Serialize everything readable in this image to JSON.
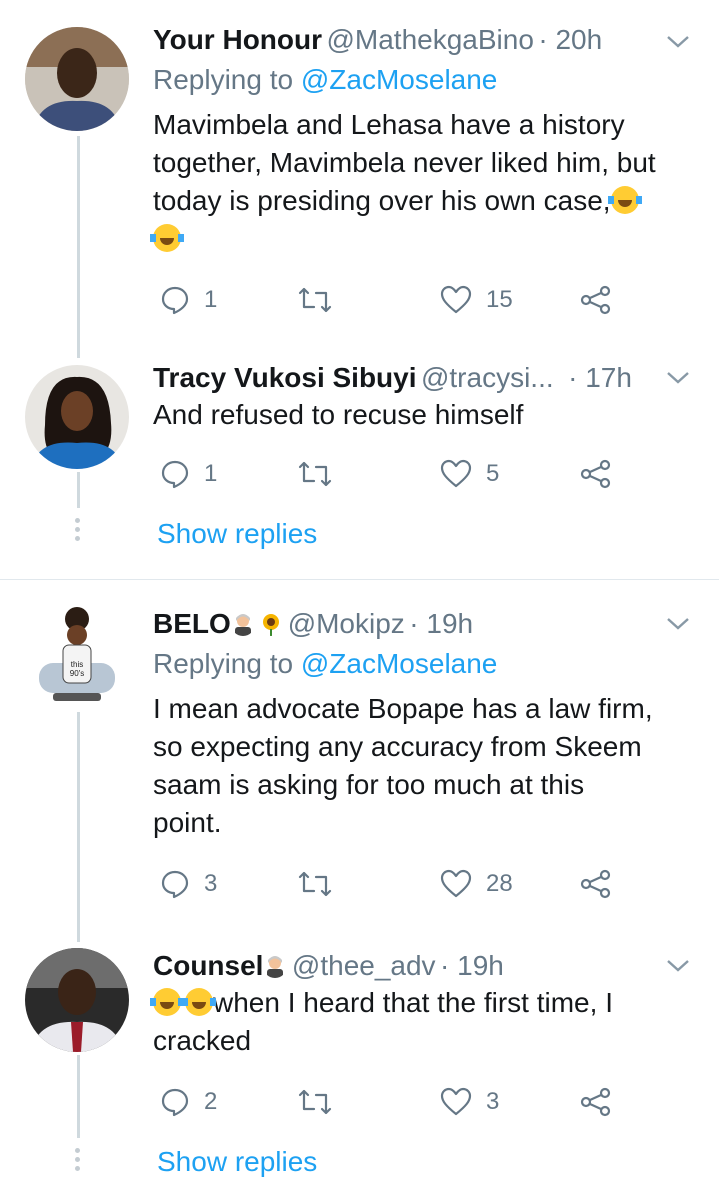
{
  "tweets": [
    {
      "name": "Your Honour",
      "handle": "@MathekgaBino",
      "time": "· 20h",
      "replying_prefix": "Replying to ",
      "replying_to": "@ZacMoselane",
      "text_line1": "Mavimbela and Lehasa have a history",
      "text_line2": "together, Mavimbela never liked him, but",
      "text_line3": "today is presiding over his own case,",
      "replies": "1",
      "likes": "15"
    },
    {
      "name": "Tracy Vukosi Sibuyi",
      "handle": "@tracysi...",
      "time": "· 17h",
      "text": "And refused to recuse himself",
      "replies": "1",
      "likes": "5"
    },
    {
      "name": "BELO",
      "handle": "@Mokipz",
      "time": "· 19h",
      "replying_prefix": "Replying to ",
      "replying_to": "@ZacMoselane",
      "text_line1": "I mean advocate Bopape has a law firm,",
      "text_line2": "so expecting any accuracy from Skeem",
      "text_line3": "saam is asking for too much at this",
      "text_line4": "point.",
      "replies": "3",
      "likes": "28"
    },
    {
      "name": "Counsel",
      "handle": "@thee_adv",
      "time": "· 19h",
      "text_line1": "when I heard that the first time, I",
      "text_line2": "cracked",
      "replies": "2",
      "likes": "3"
    }
  ],
  "show_replies_label": "Show replies",
  "colors": {
    "link": "#1da1f2",
    "muted": "#657786",
    "line": "#cfd9de"
  }
}
